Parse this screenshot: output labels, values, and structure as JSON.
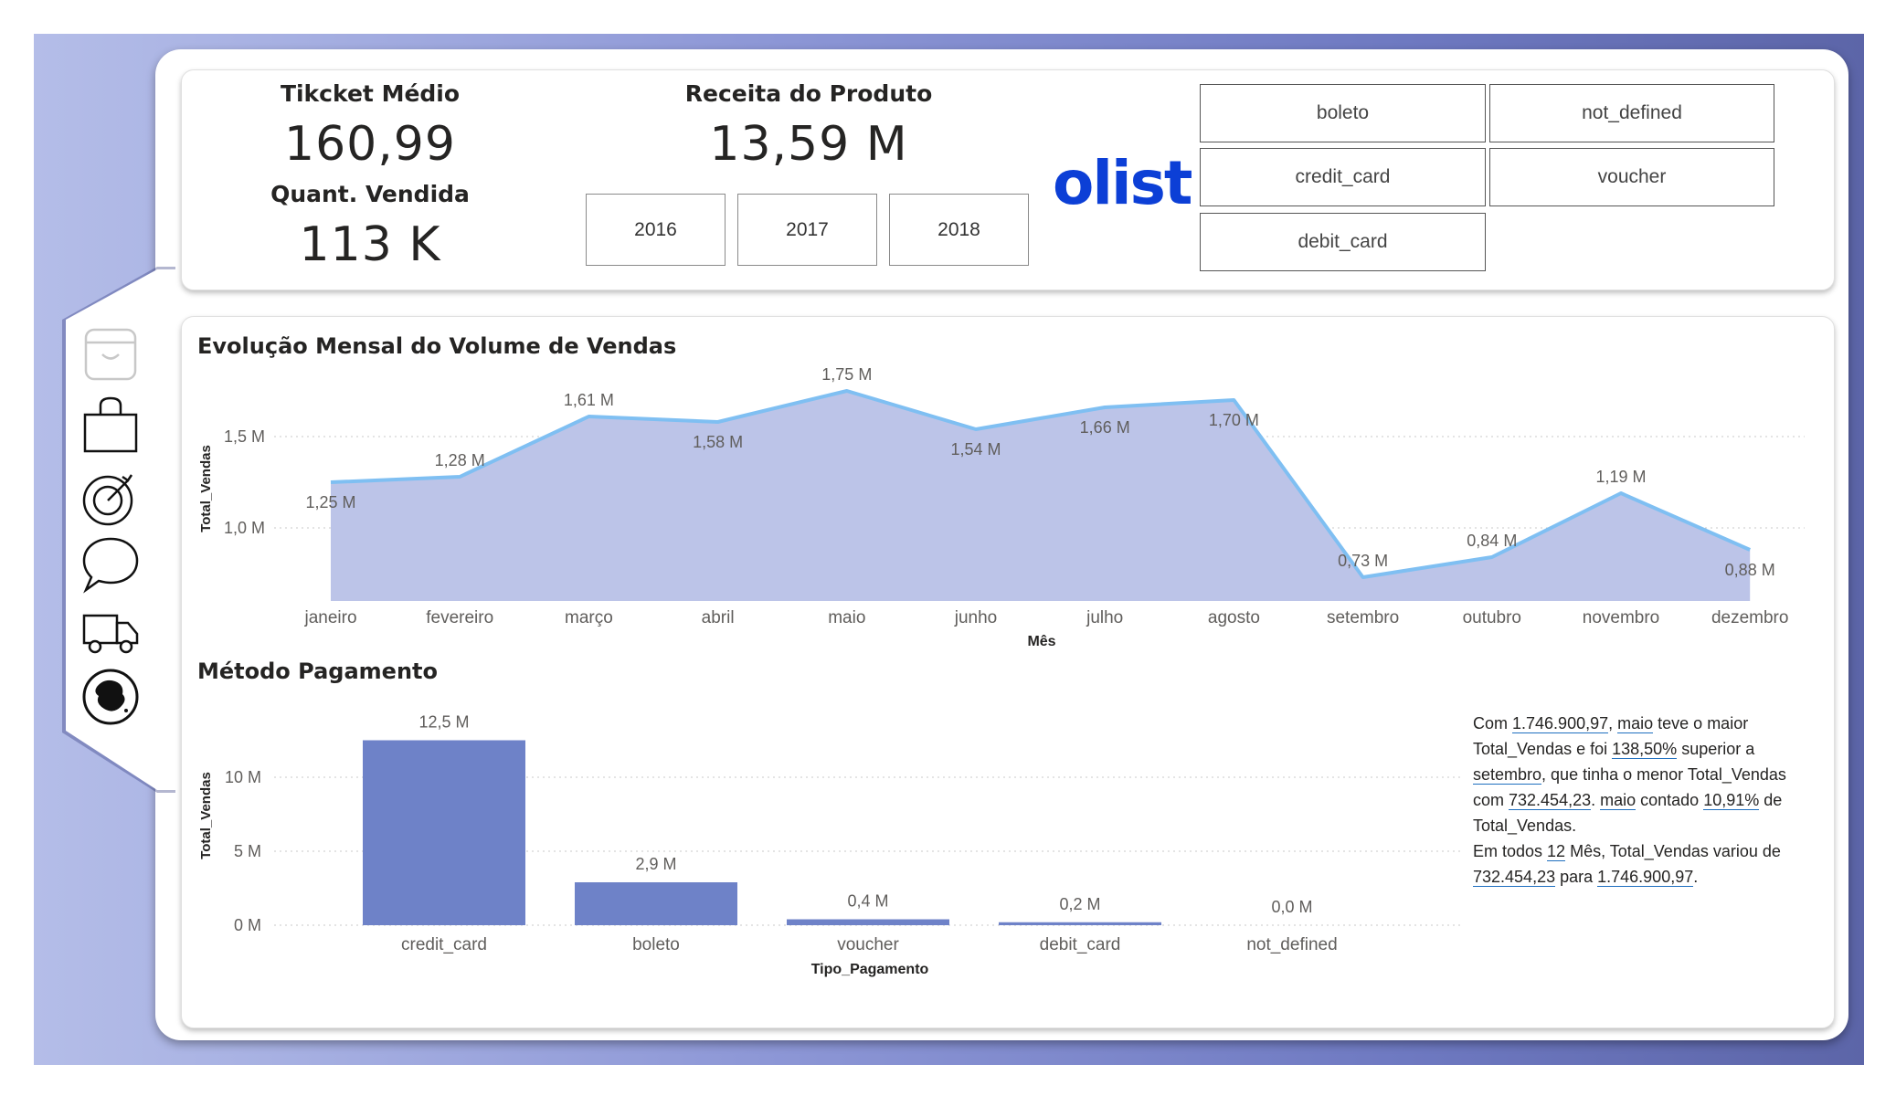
{
  "kpis": {
    "ticket_medio": {
      "title": "Tikcket Médio",
      "value": "160,99"
    },
    "quant_vendida": {
      "title": "Quant. Vendida",
      "value": "113 K"
    },
    "receita": {
      "title": "Receita do Produto",
      "value": "13,59 M"
    }
  },
  "year_slicer": [
    "2016",
    "2017",
    "2018"
  ],
  "payment_slicer": [
    "boleto",
    "not_defined",
    "credit_card",
    "voucher",
    "debit_card"
  ],
  "logo_text": "olist",
  "nav_icons": [
    "store-icon",
    "shopping-bag-icon",
    "target-icon",
    "chat-icon",
    "truck-icon",
    "globe-icon"
  ],
  "colors": {
    "area_fill": "#bcc4e8",
    "area_line": "#7fbff2",
    "bar": "#6e82c8",
    "frame": "#7f89cf"
  },
  "charts_meta": {
    "area_title": "Evolução Mensal do Volume de Vendas",
    "bar_title": "Método Pagamento"
  },
  "chart_data": [
    {
      "type": "area",
      "title": "Evolução Mensal do Volume de Vendas",
      "xlabel": "Mês",
      "ylabel": "Total_Vendas",
      "categories": [
        "janeiro",
        "fevereiro",
        "março",
        "abril",
        "maio",
        "junho",
        "julho",
        "agosto",
        "setembro",
        "outubro",
        "novembro",
        "dezembro"
      ],
      "values": [
        1.25,
        1.28,
        1.61,
        1.58,
        1.75,
        1.54,
        1.66,
        1.7,
        0.73,
        0.84,
        1.19,
        0.88
      ],
      "data_labels": [
        "1,25 M",
        "1,28 M",
        "1,61 M",
        "1,58 M",
        "1,75 M",
        "1,54 M",
        "1,66 M",
        "1,70 M",
        "0,73 M",
        "0,84 M",
        "1,19 M",
        "0,88 M"
      ],
      "y_ticks": [
        {
          "value": 1.0,
          "label": "1,0 M"
        },
        {
          "value": 1.5,
          "label": "1,5 M"
        }
      ],
      "ylim": [
        0.6,
        1.82
      ],
      "grid": true
    },
    {
      "type": "bar",
      "title": "Método Pagamento",
      "xlabel": "Tipo_Pagamento",
      "ylabel": "Total_Vendas",
      "categories": [
        "credit_card",
        "boleto",
        "voucher",
        "debit_card",
        "not_defined"
      ],
      "values": [
        12.5,
        2.9,
        0.4,
        0.2,
        0.0
      ],
      "data_labels": [
        "12,5 M",
        "2,9 M",
        "0,4 M",
        "0,2 M",
        "0,0 M"
      ],
      "y_ticks": [
        {
          "value": 0,
          "label": "0 M"
        },
        {
          "value": 5,
          "label": "5 M"
        },
        {
          "value": 10,
          "label": "10 M"
        }
      ],
      "ylim": [
        0,
        13.5
      ],
      "grid": true
    }
  ],
  "narrative": {
    "parts": [
      {
        "t": "Com ",
        "h": false
      },
      {
        "t": "1.746.900,97",
        "h": true
      },
      {
        "t": ", ",
        "h": false
      },
      {
        "t": "maio",
        "h": true
      },
      {
        "t": " teve o maior Total_Vendas e foi ",
        "h": false
      },
      {
        "t": "138,50%",
        "h": true
      },
      {
        "t": " superior a ",
        "h": false
      },
      {
        "t": "setembro",
        "h": true
      },
      {
        "t": ", que tinha o menor Total_Vendas com ",
        "h": false
      },
      {
        "t": "732.454,23",
        "h": true
      },
      {
        "t": ". ",
        "h": false
      },
      {
        "t": "maio",
        "h": true
      },
      {
        "t": " contado ",
        "h": false
      },
      {
        "t": "10,91%",
        "h": true
      },
      {
        "t": " de Total_Vendas.",
        "h": false
      },
      {
        "br": true
      },
      {
        "t": "Em todos ",
        "h": false
      },
      {
        "t": "12",
        "h": true
      },
      {
        "t": " Mês, Total_Vendas variou de ",
        "h": false
      },
      {
        "t": "732.454,23",
        "h": true
      },
      {
        "t": " para ",
        "h": false
      },
      {
        "t": "1.746.900,97",
        "h": true
      },
      {
        "t": ".",
        "h": false
      }
    ]
  }
}
